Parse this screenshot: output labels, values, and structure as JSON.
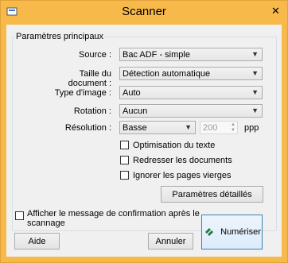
{
  "window": {
    "title": "Scanner"
  },
  "main_settings": {
    "group_title": "Paramètres principaux",
    "source": {
      "label": "Source :",
      "value": "Bac ADF - simple"
    },
    "document_size": {
      "label": "Taille du document :",
      "value": "Détection automatique"
    },
    "image_type": {
      "label": "Type d'image :",
      "value": "Auto"
    },
    "rotation": {
      "label": "Rotation :",
      "value": "Aucun"
    },
    "resolution": {
      "label": "Résolution :",
      "value": "Basse",
      "number": "200",
      "unit": "ppp"
    },
    "options": [
      {
        "label": "Optimisation du texte",
        "checked": false
      },
      {
        "label": "Redresser les documents",
        "checked": false
      },
      {
        "label": "Ignorer les pages vierges",
        "checked": false
      }
    ],
    "advanced_button": "Paramètres détaillés"
  },
  "confirmation": {
    "label_line1": "Afficher le message de confirmation après le",
    "label_line2": "scannage",
    "checked": false
  },
  "buttons": {
    "help": "Aide",
    "cancel": "Annuler",
    "scan": "Numériser"
  }
}
